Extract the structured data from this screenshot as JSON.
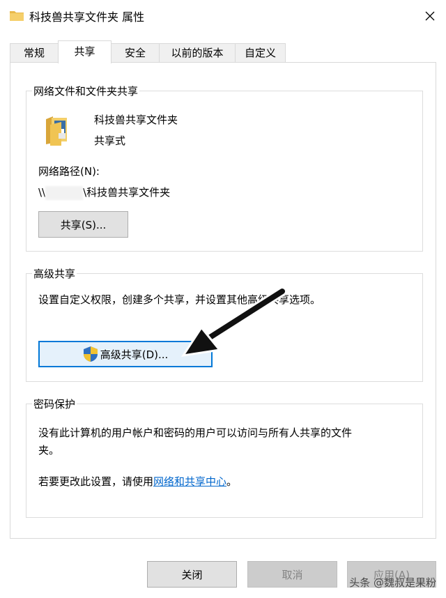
{
  "window": {
    "title": "科技兽共享文件夹 属性",
    "close_icon": "close-icon"
  },
  "tabs": [
    {
      "label": "常规"
    },
    {
      "label": "共享"
    },
    {
      "label": "安全"
    },
    {
      "label": "以前的版本"
    },
    {
      "label": "自定义"
    }
  ],
  "network_sharing": {
    "legend": "网络文件和文件夹共享",
    "folder_name": "科技兽共享文件夹",
    "status": "共享式",
    "path_label": "网络路径(N):",
    "path_prefix": "\\\\",
    "path_suffix": "\\科技兽共享文件夹",
    "share_button": "共享(S)..."
  },
  "advanced_sharing": {
    "legend": "高级共享",
    "description": "设置自定义权限，创建多个共享，并设置其他高级共享选项。",
    "button": "高级共享(D)..."
  },
  "password_protection": {
    "legend": "密码保护",
    "description_line1": "没有此计算机的用户帐户和密码的用户可以访问与所有人共享的文件",
    "description_line2": "夹。",
    "change_prefix": "若要更改此设置，请使用",
    "change_link": "网络和共享中心",
    "change_suffix": "。"
  },
  "footer": {
    "close_button": "关闭",
    "cancel_button": "取消",
    "apply_button": "应用(A)"
  },
  "watermark": "头条 @魏叔是果粉"
}
